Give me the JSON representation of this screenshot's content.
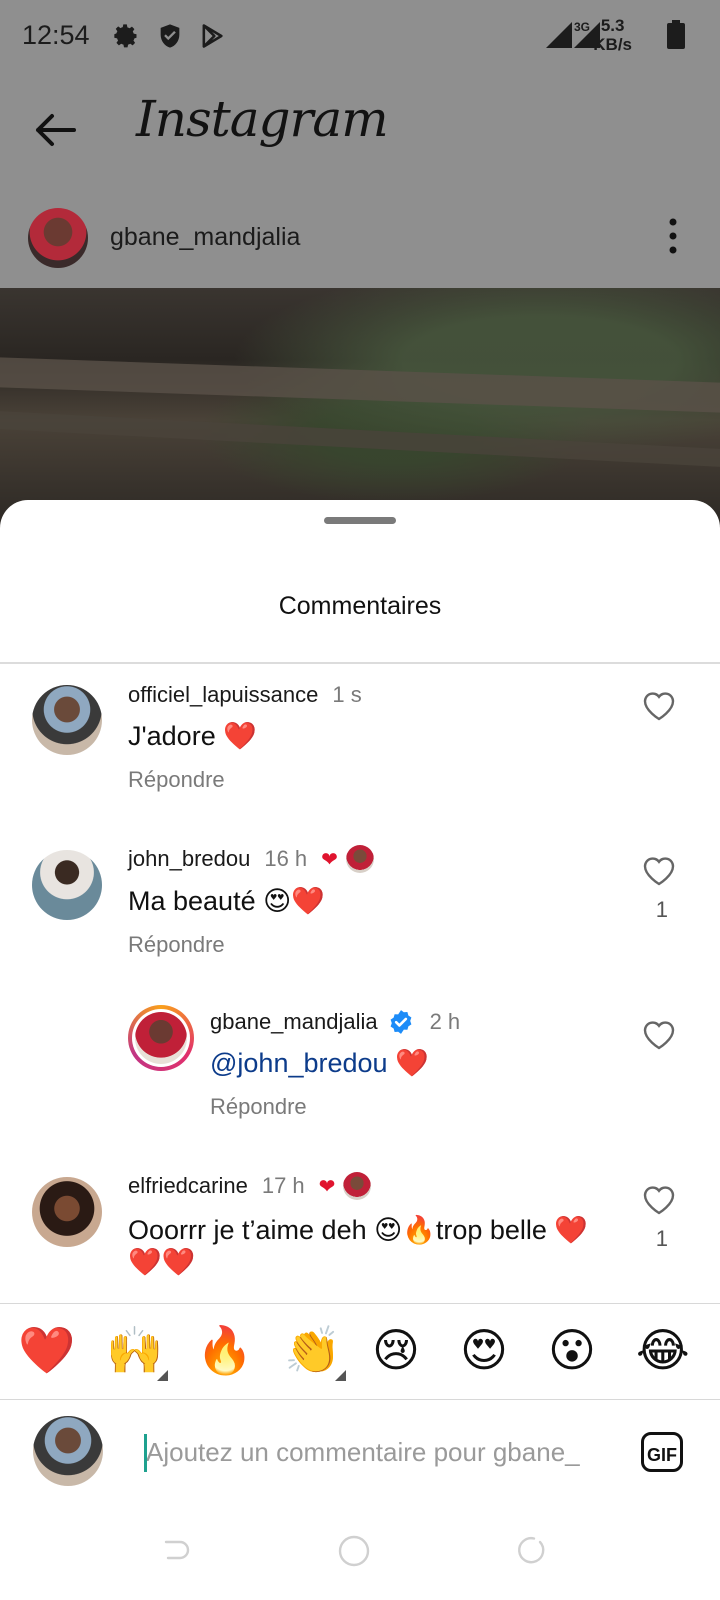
{
  "status_bar": {
    "time": "12:54",
    "network_type": "3G",
    "speed_value": "5.3",
    "speed_unit": "KB/s",
    "icons": [
      "settings-icon",
      "shield-icon",
      "play-store-icon",
      "signal-icon",
      "battery-icon"
    ]
  },
  "app_bar": {
    "title": "Instagram",
    "back_icon": "arrow-left-icon"
  },
  "post": {
    "username": "gbane_mandjalia",
    "more_icon": "more-vertical-icon"
  },
  "sheet": {
    "title": "Commentaires"
  },
  "comments": [
    {
      "username": "officiel_lapuissance",
      "time": "1 s",
      "text": "J'adore ❤️",
      "reply_label": "Répondre",
      "like_count": "",
      "liked_by_author": false
    },
    {
      "username": "john_bredou",
      "time": "16 h",
      "text": "Ma beauté 😍❤️",
      "reply_label": "Répondre",
      "like_count": "1",
      "liked_by_author": true
    },
    {
      "username": "gbane_mandjalia",
      "time": "2 h",
      "mention": "@john_bredou",
      "text": "❤️",
      "reply_label": "Répondre",
      "like_count": "",
      "verified": true,
      "is_reply": true
    },
    {
      "username": "elfriedcarine",
      "time": "17 h",
      "text": "Ooorrr je t’aime deh 😍🔥trop belle ❤️",
      "text_line2": "❤️❤️",
      "like_count": "1",
      "liked_by_author": true
    }
  ],
  "reactions": [
    "❤️",
    "🙌",
    "🔥",
    "👏",
    "😢",
    "😍",
    "😮",
    "😂"
  ],
  "composer": {
    "placeholder": "Ajoutez un commentaire pour gbane_",
    "gif_label": "GIF"
  },
  "nav": {
    "icons": [
      "back-nav-icon",
      "home-nav-icon",
      "recents-nav-icon"
    ]
  },
  "colors": {
    "like_red": "#e0142e",
    "mention_blue": "#0c3b8a",
    "verified_blue": "#1d8cf8",
    "cursor_teal": "#1ea18f"
  }
}
